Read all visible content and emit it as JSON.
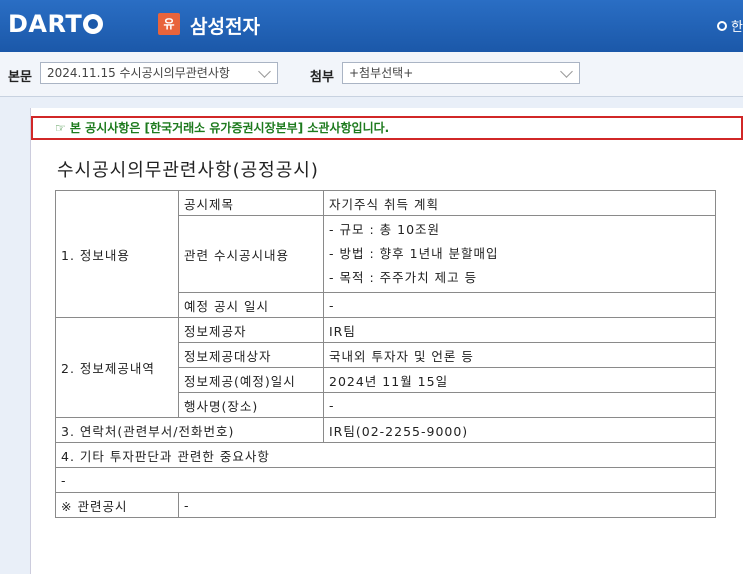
{
  "header": {
    "logo_text": "DART",
    "company_badge": "유",
    "company_name": "삼성전자",
    "right_text": "한"
  },
  "selectors": {
    "main_label": "본문",
    "main_value": "2024.11.15  수시공시의무관련사항",
    "attach_label": "첨부",
    "attach_value": "+첨부선택+"
  },
  "document": {
    "notice": "☞ 본 공시사항은 [한국거래소 유가증권시장본부] 소관사항입니다.",
    "title": "수시공시의무관련사항(공정공시)",
    "table": {
      "sec1": "1. 정보내용",
      "sec1_title_label": "공시제목",
      "sec1_title_value": "자기주식 취득 계획",
      "sec1_related_label": "관련 수시공시내용",
      "sec1_related_lines": [
        "- 규모 : 총 10조원",
        "- 방법 : 향후 1년내 분할매입",
        "- 목적 : 주주가치 제고 등"
      ],
      "sec1_date_label": "예정 공시 일시",
      "sec1_date_value": "-",
      "sec2": "2. 정보제공내역",
      "sec2_provider_label": "정보제공자",
      "sec2_provider_value": "IR팀",
      "sec2_target_label": "정보제공대상자",
      "sec2_target_value": "국내외 투자자 및 언론 등",
      "sec2_date_label": "정보제공(예정)일시",
      "sec2_date_value": "2024년 11월 15일",
      "sec2_event_label": "행사명(장소)",
      "sec2_event_value": "-",
      "sec3_label": "3. 연락처(관련부서/전화번호)",
      "sec3_value": "IR팀(02-2255-9000)",
      "sec4_label": "4. 기타 투자판단과 관련한 중요사항",
      "sec4_value": "-",
      "related_label": "※ 관련공시",
      "related_value": "-"
    }
  }
}
